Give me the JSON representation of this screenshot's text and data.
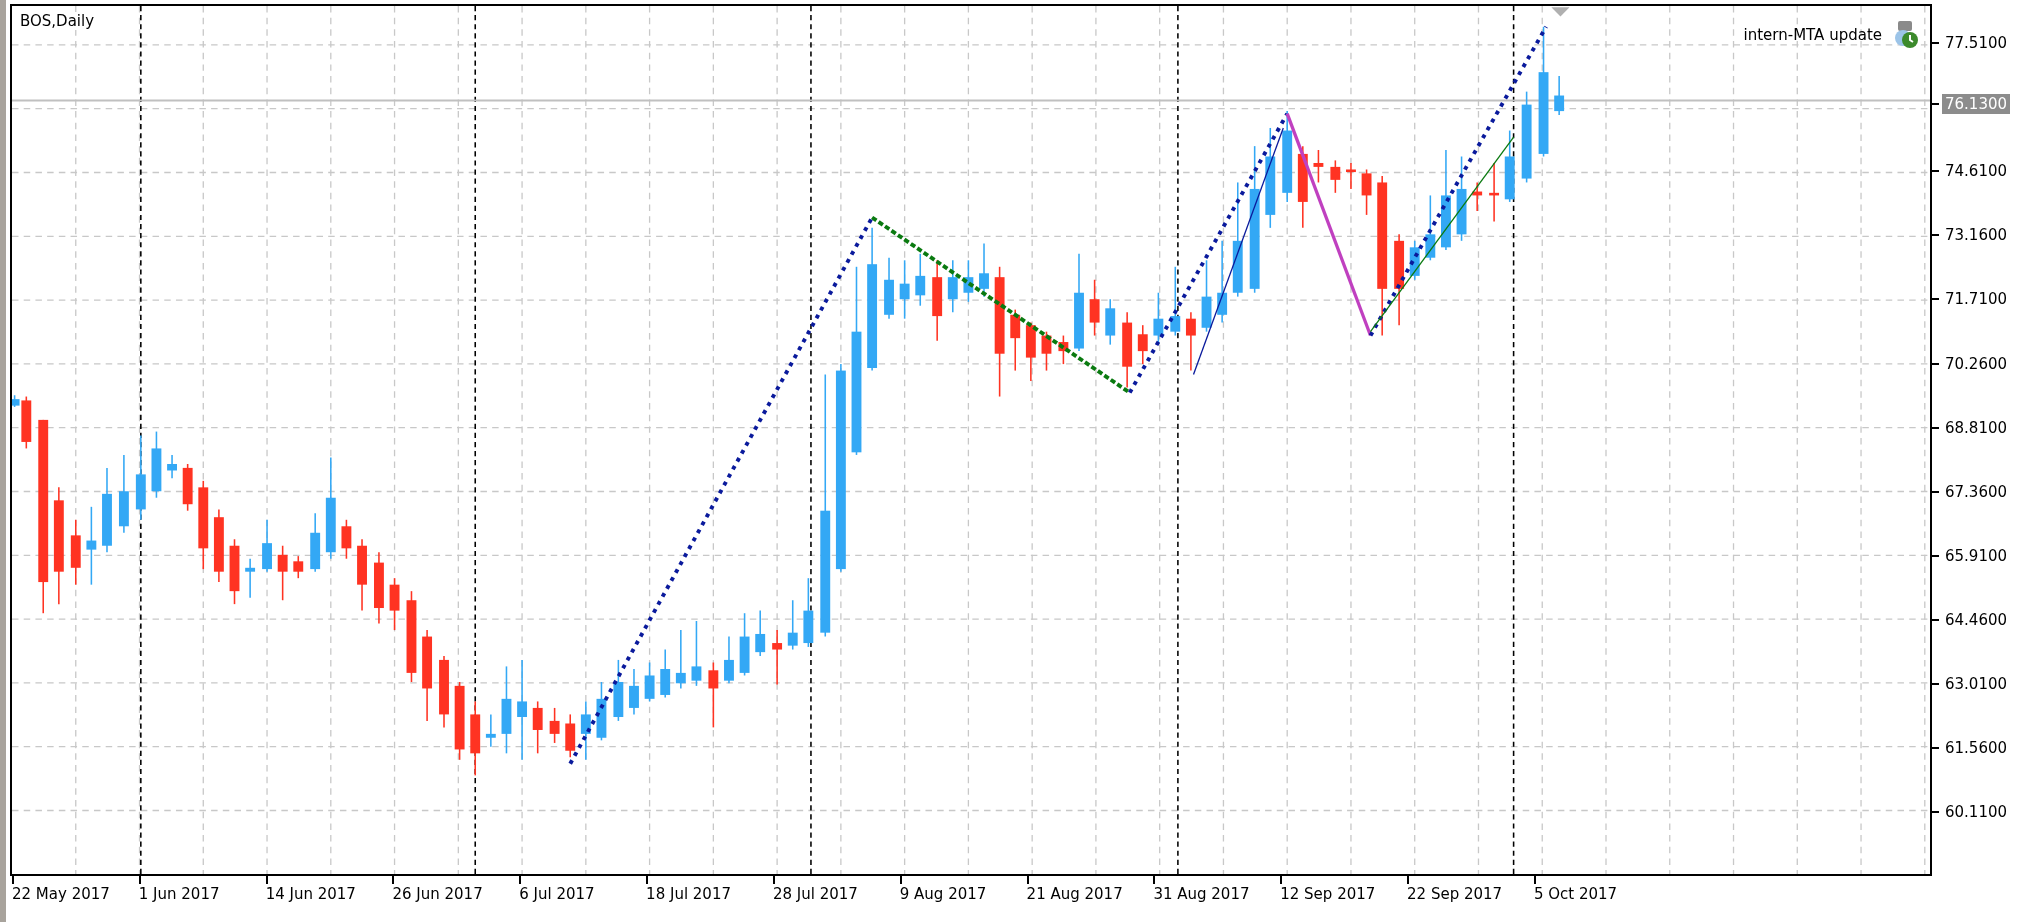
{
  "chart": {
    "title": "BOS,Daily",
    "indicator_label": "intern-MTA update",
    "current_price": "76.1300",
    "price_ticks": [
      "77.5100",
      "74.6100",
      "73.1600",
      "71.7100",
      "70.2600",
      "68.8100",
      "67.3600",
      "65.9100",
      "64.4600",
      "63.0100",
      "61.5600",
      "60.1100"
    ],
    "date_labels": [
      "22 May 2017",
      "1 Jun 2017",
      "14 Jun 2017",
      "26 Jun 2017",
      "6 Jul 2017",
      "18 Jul 2017",
      "28 Jul 2017",
      "9 Aug 2017",
      "21 Aug 2017",
      "31 Aug 2017",
      "12 Sep 2017",
      "22 Sep 2017",
      "5 Oct 2017"
    ]
  }
}
